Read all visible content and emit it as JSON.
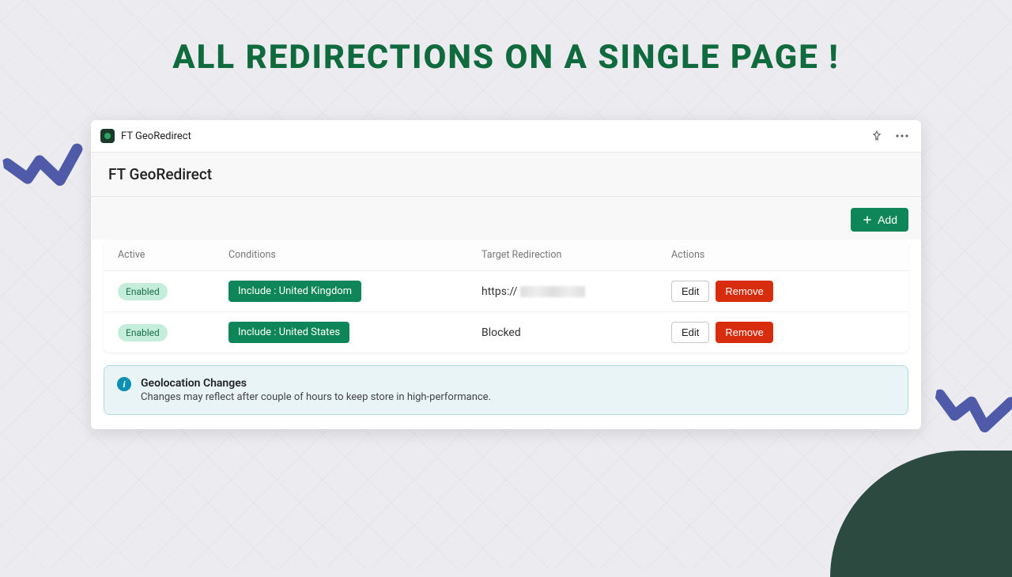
{
  "page_title": "ALL REDIRECTIONS ON A SINGLE PAGE !",
  "app_bar": {
    "name": "FT GeoRedirect"
  },
  "section_title": "FT GeoRedirect",
  "toolbar": {
    "add_label": "Add"
  },
  "columns": {
    "active": "Active",
    "conditions": "Conditions",
    "target": "Target Redirection",
    "actions": "Actions"
  },
  "rows": [
    {
      "status": "Enabled",
      "condition": "Include : United Kingdom",
      "target_prefix": "https://",
      "target_blurred": true,
      "target": ""
    },
    {
      "status": "Enabled",
      "condition": "Include : United States",
      "target_prefix": "",
      "target_blurred": false,
      "target": "Blocked"
    }
  ],
  "actions_labels": {
    "edit": "Edit",
    "remove": "Remove"
  },
  "info": {
    "title": "Geolocation Changes",
    "text": "Changes may reflect after couple of hours to keep store in high-performance."
  },
  "colors": {
    "brand_green": "#0f865a",
    "title_green": "#0f6a3d",
    "danger": "#d72c0d",
    "badge_bg": "#c5eddb"
  }
}
